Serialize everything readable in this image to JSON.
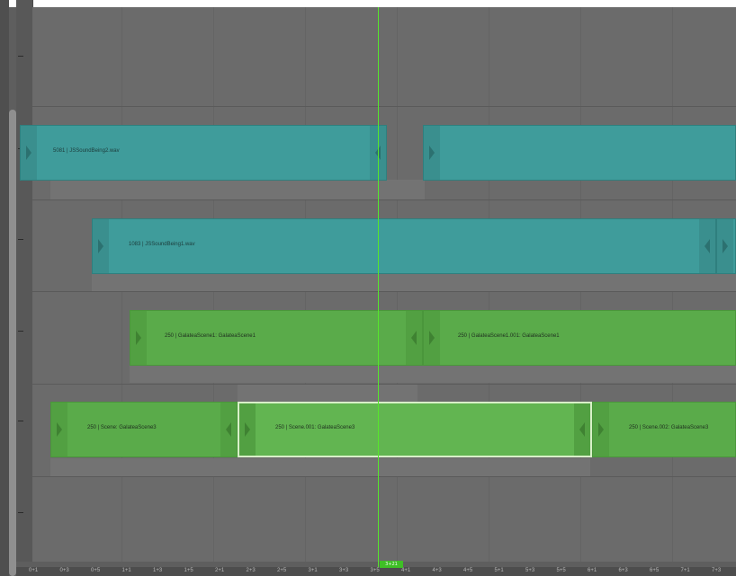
{
  "colors": {
    "background": "#5e5e5e",
    "sound_strip": "#3f9c9b",
    "scene_strip": "#5aab4a",
    "playhead": "#57e62c"
  },
  "icons": [
    "left-handle-arrow-icon",
    "right-handle-arrow-icon"
  ],
  "playhead": {
    "frame_label": "3+21"
  },
  "strips": {
    "sound1": {
      "label": "5081 | JSSoundBeing2.wav"
    },
    "sound2": {
      "label": ""
    },
    "sound3": {
      "label": "1083 | JSSoundBeing1.wav"
    },
    "scene1": {
      "label": "250 | GalateaScene1: GalateaScene1"
    },
    "scene2": {
      "label": "250 | GalateaScene1.001: GalateaScene1"
    },
    "scene3": {
      "label": "250 | Scene: GalateaScene3"
    },
    "scene4": {
      "label": "250 | Scene.001: GalateaScene3"
    },
    "scene5": {
      "label": "250 | Scene.002: GalateaScene3"
    }
  },
  "ruler": {
    "ticks": [
      "0+1",
      "0+3",
      "0+5",
      "1+1",
      "1+3",
      "1+5",
      "2+1",
      "2+3",
      "2+5",
      "3+1",
      "3+3",
      "3+5",
      "4+1",
      "4+3",
      "4+5",
      "5+1",
      "5+3",
      "5+5",
      "6+1",
      "6+3",
      "6+5",
      "7+1",
      "7+3"
    ]
  }
}
